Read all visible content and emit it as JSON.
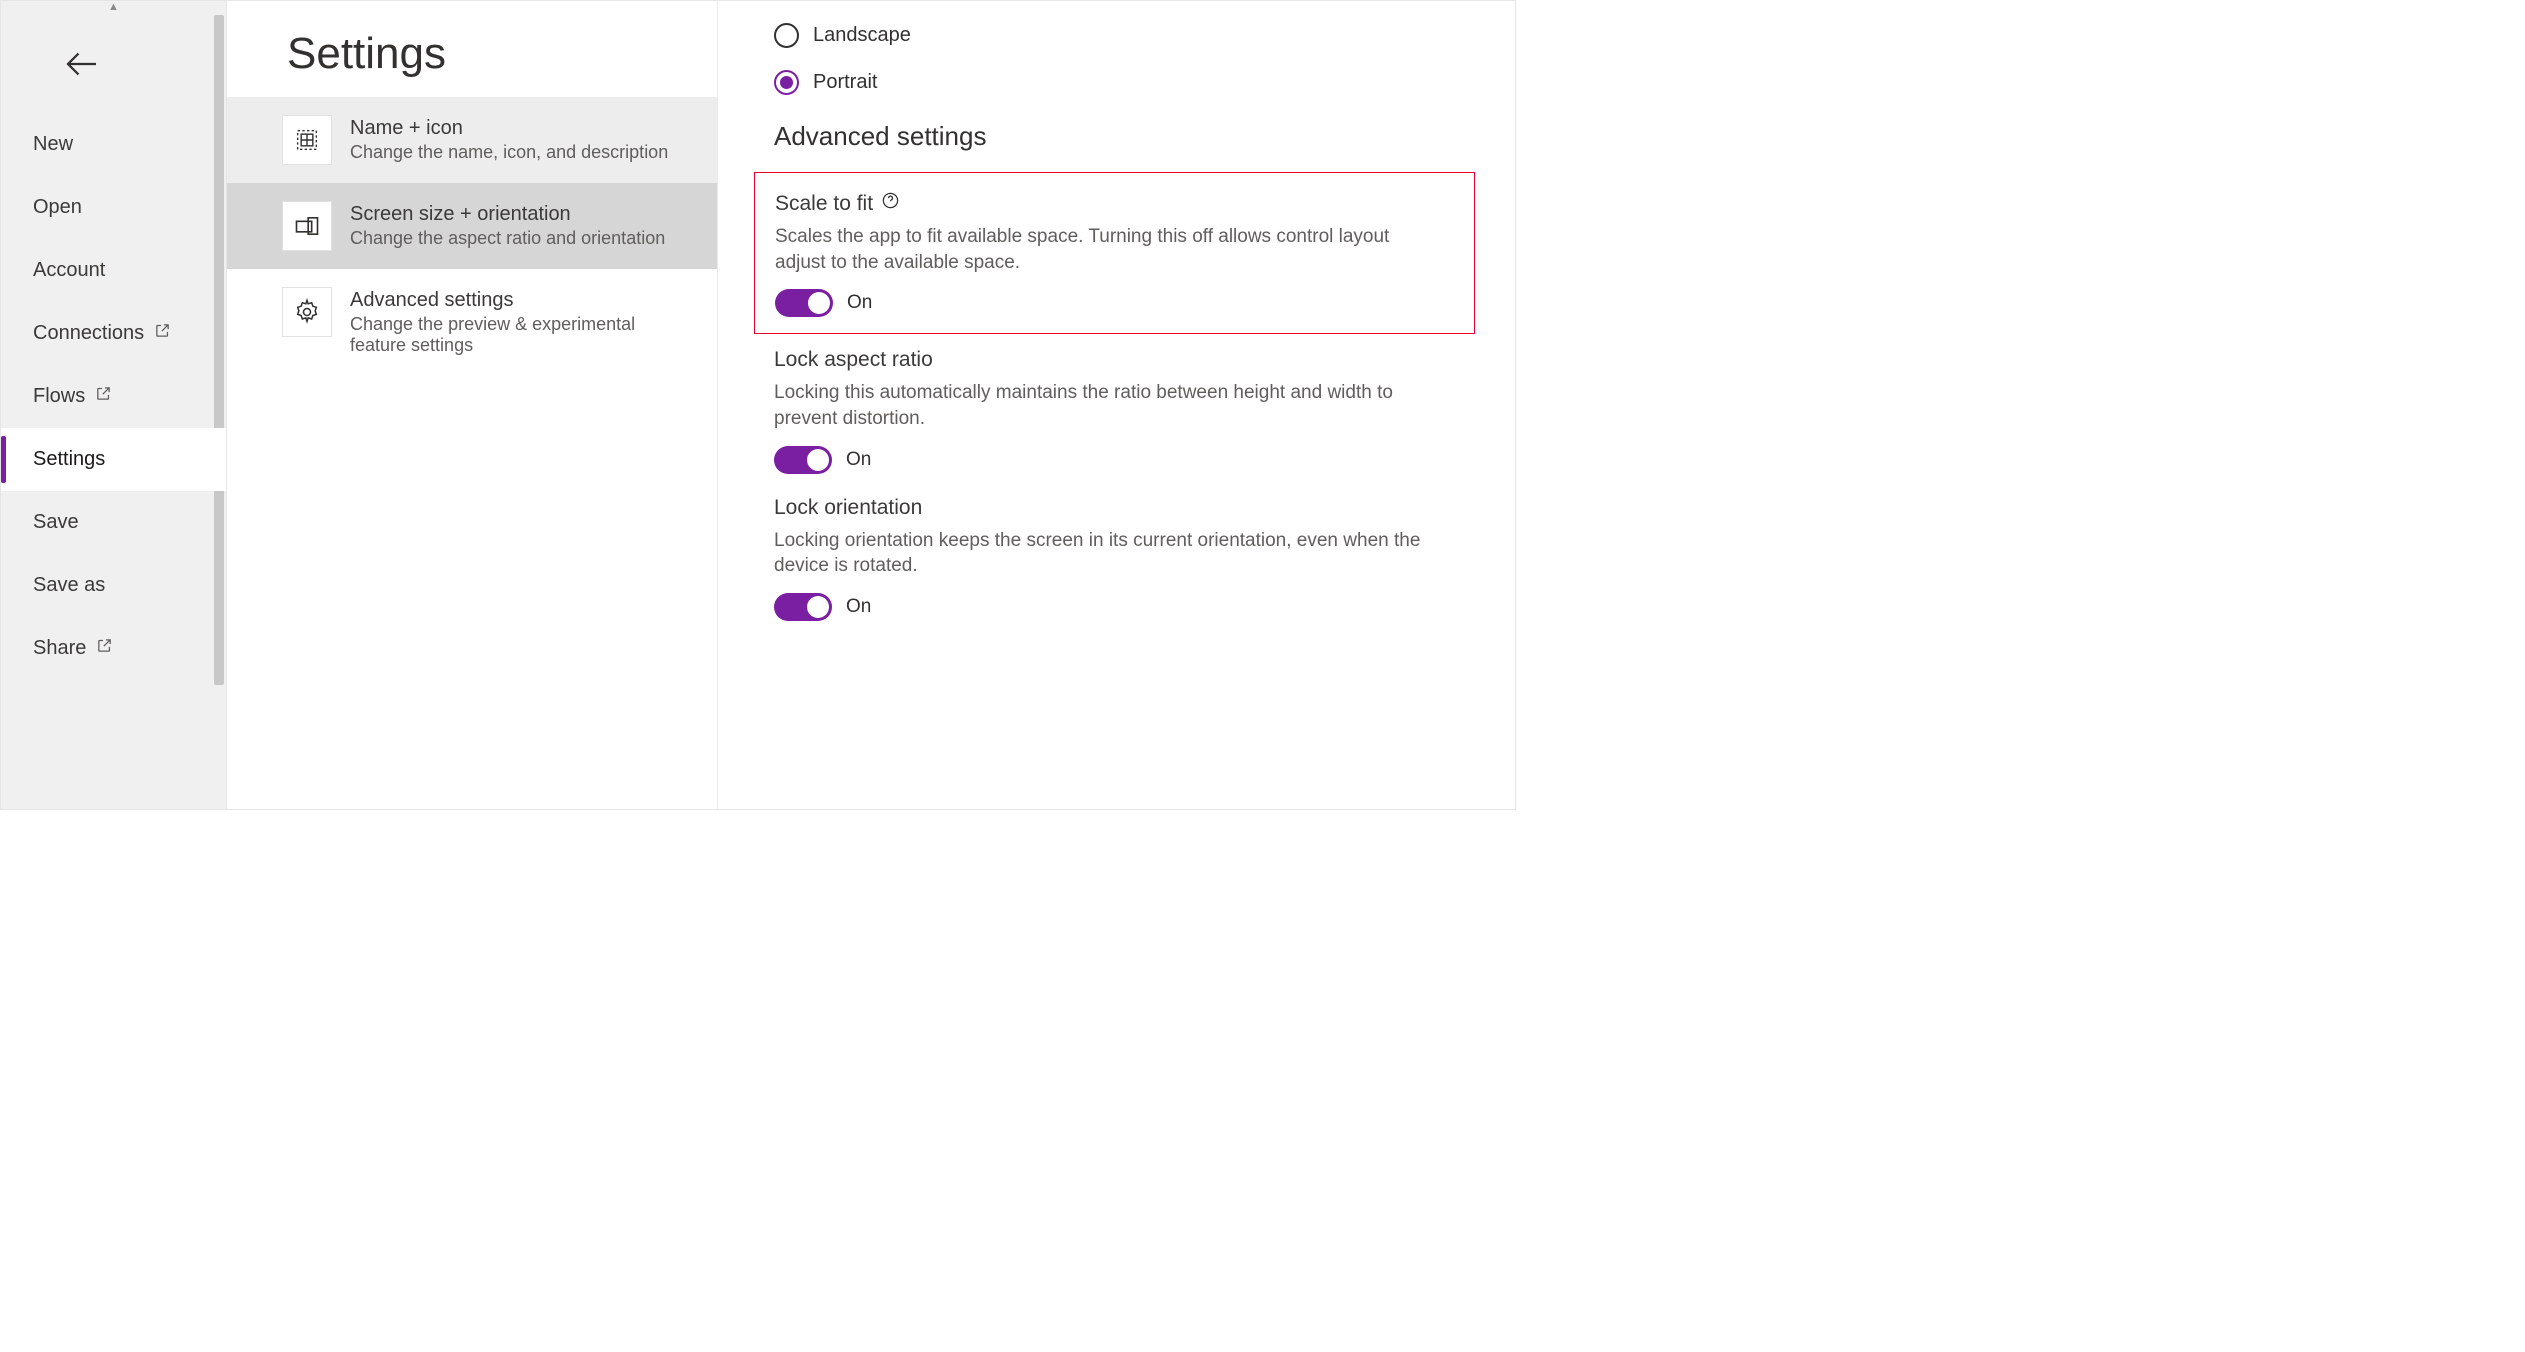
{
  "nav": {
    "items": [
      {
        "label": "New"
      },
      {
        "label": "Open"
      },
      {
        "label": "Account"
      },
      {
        "label": "Connections"
      },
      {
        "label": "Flows"
      },
      {
        "label": "Settings"
      },
      {
        "label": "Save"
      },
      {
        "label": "Save as"
      },
      {
        "label": "Share"
      }
    ]
  },
  "page": {
    "title": "Settings"
  },
  "cards": [
    {
      "title": "Name + icon",
      "desc": "Change the name, icon, and description"
    },
    {
      "title": "Screen size + orientation",
      "desc": "Change the aspect ratio and orientation"
    },
    {
      "title": "Advanced settings",
      "desc": "Change the preview & experimental feature settings"
    }
  ],
  "orientation": {
    "landscape": "Landscape",
    "portrait": "Portrait"
  },
  "advanced": {
    "heading": "Advanced settings",
    "scale": {
      "title": "Scale to fit",
      "desc": "Scales the app to fit available space. Turning this off allows control layout adjust to the available space.",
      "state": "On"
    },
    "aspect": {
      "title": "Lock aspect ratio",
      "desc": "Locking this automatically maintains the ratio between height and width to prevent distortion.",
      "state": "On"
    },
    "lockorient": {
      "title": "Lock orientation",
      "desc": "Locking orientation keeps the screen in its current orientation, even when the device is rotated.",
      "state": "On"
    }
  }
}
